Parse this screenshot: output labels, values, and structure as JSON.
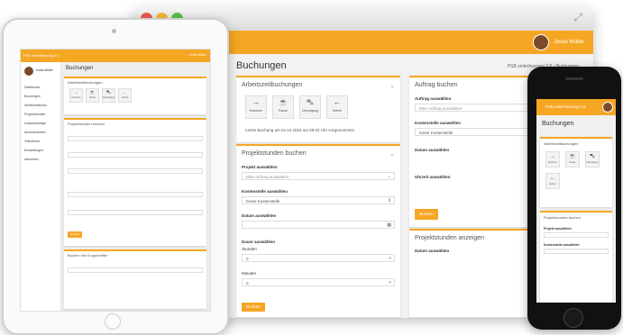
{
  "colors": {
    "accent": "#f5a623",
    "window_bg": "#f2f2f2"
  },
  "desktop": {
    "user_name": "Jonas Müller",
    "page_title": "Buchungen",
    "breadcrumb": "PSB zeiterfassung 2.0  ›  Buchungen",
    "arbeitszeit": {
      "title": "Arbeitszeitbuchungen",
      "tiles": [
        "Kommen",
        "Pause",
        "Dienstgang",
        "Gehen"
      ],
      "status": "Letzte Buchung am 04.12.2015 um 09:32 Uhr vorgenommen"
    },
    "projektstunden": {
      "title": "Projektstunden buchen",
      "projekt_label": "Projekt auswählen",
      "projekt_placeholder": "Bitte Auftrag auswählen",
      "kostenstelle_label": "Kostenstelle auswählen",
      "kostenstelle_value": "Keine Kostenstelle",
      "datum_label": "Datum auswählen",
      "zeitraum_label": "Dauer auswählen",
      "stunden_label": "Stunden",
      "stunden_value": "0",
      "minuten_label": "Minuten",
      "minuten_value": "0",
      "button": "Buchen"
    },
    "auftrag": {
      "title": "Auftrag buchen",
      "auftrag_label": "Auftrag auswählen",
      "auftrag_placeholder": "Bitte Auftrag auswählen",
      "kostenstelle_label": "Kostenstelle auswählen",
      "kostenstelle_value": "Keine Kostenstelle",
      "datum_label": "Datum auswählen",
      "uhrzeit_label": "Uhrzeit auswählen",
      "button": "Buchen"
    },
    "anzeigen": {
      "title": "Projektstunden anzeigen",
      "datum_label": "Datum auswählen"
    }
  },
  "tablet": {
    "logo": "PSB zeiterfassung 2.0",
    "top_user": "Jonas Müller",
    "user_name": "Jonas Müller",
    "page_title": "Buchungen",
    "nav": [
      "Dashboard",
      "Buchungen",
      "Arbeitszeitkonto",
      "Projektstunden",
      "Urlaubsanträge",
      "Abwesenheiten",
      "Teilnehmer",
      "Einstellungen",
      "Abmelden"
    ],
    "panel1": "Arbeitszeitbuchungen",
    "tiles": [
      "Kommen",
      "Pause",
      "Dienstgang",
      "Gehen"
    ],
    "panel2": "Projektstunden buchen",
    "panel3": "Buchen mit Gruppenfilter",
    "button": "Buchen"
  },
  "phone": {
    "logo": "PSB zeiterfassung 2.0",
    "page_title": "Buchungen",
    "panel1": "Arbeitszeitbuchungen",
    "tiles": [
      "Kommen",
      "Pause",
      "Dienstgang",
      "Gehen"
    ],
    "panel2": "Projektstunden buchen",
    "projekt_label": "Projekt auswählen",
    "kostenstelle_label": "Kostenstelle auswählen"
  }
}
